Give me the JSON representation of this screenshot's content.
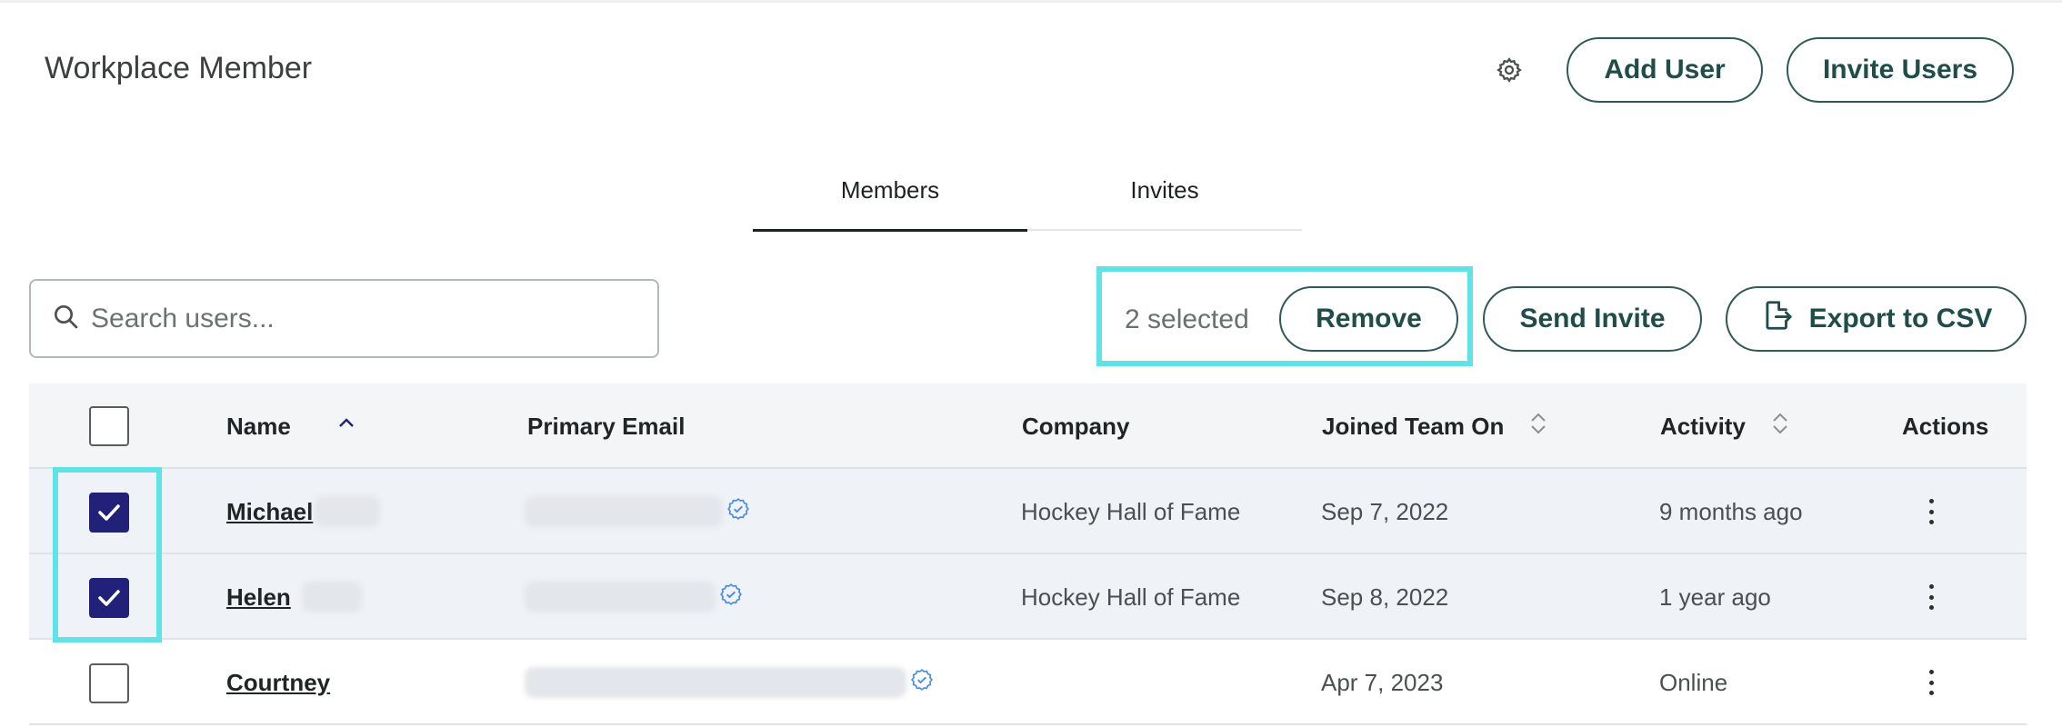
{
  "header": {
    "title": "Workplace Member",
    "settings_icon": "gear-icon",
    "add_user_label": "Add User",
    "invite_users_label": "Invite Users"
  },
  "tabs": [
    {
      "label": "Members",
      "active": true
    },
    {
      "label": "Invites",
      "active": false
    }
  ],
  "search": {
    "placeholder": "Search users...",
    "value": ""
  },
  "selection": {
    "text": "2 selected",
    "remove_label": "Remove"
  },
  "toolbar": {
    "send_invite_label": "Send Invite",
    "export_label": "Export to CSV"
  },
  "table": {
    "columns": [
      "Name",
      "Primary Email",
      "Company",
      "Joined Team On",
      "Activity",
      "Actions"
    ],
    "rows": [
      {
        "selected": true,
        "name": "Michael",
        "company": "Hockey Hall of Fame",
        "joined": "Sep 7, 2022",
        "activity": "9 months ago"
      },
      {
        "selected": true,
        "name": "Helen",
        "company": "Hockey Hall of Fame",
        "joined": "Sep 8, 2022",
        "activity": "1 year ago"
      },
      {
        "selected": false,
        "name": "Courtney",
        "company": "",
        "joined": "Apr 7, 2023",
        "activity": "Online"
      }
    ]
  },
  "colors": {
    "accent": "#2e5b58",
    "highlight": "#5fe3e6",
    "checkbox_checked": "#22217a",
    "verified": "#4a8fe7"
  }
}
